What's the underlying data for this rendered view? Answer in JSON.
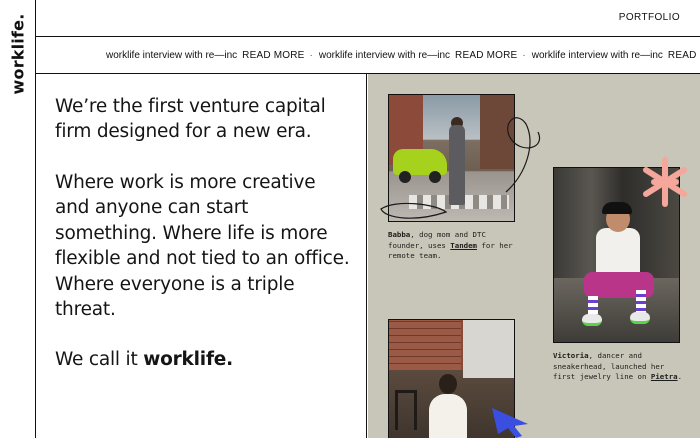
{
  "brand": {
    "logo_text": "worklife."
  },
  "nav": {
    "portfolio_label": "PORTFOLIO"
  },
  "ticker": {
    "items": [
      {
        "text": "worklife interview with re—inc",
        "link": "READ MORE",
        "separator": "·"
      },
      {
        "text": "worklife interview with re—inc",
        "link": "READ MORE",
        "separator": "·"
      },
      {
        "text": "worklife interview with re—inc",
        "link": "READ MORE",
        "separator": ""
      }
    ]
  },
  "main": {
    "intro": "We’re the first venture capital firm designed for a new era.",
    "body": "Where work is more creative and anyone can start something. Where life is more flexible and not tied to an office. Where everyone is a triple threat.",
    "closing_prefix": "We call it",
    "closing_emphasis": "worklife."
  },
  "gallery": {
    "captions": [
      {
        "name": "Babba",
        "text_before": ", dog mom and DTC founder, uses ",
        "link": "Tandem",
        "text_after": " for her remote team."
      },
      {
        "name": "Victoria",
        "text_before": ", dancer and sneakerhead, launched her first jewelry line on ",
        "link": "Pietra",
        "text_after": "."
      }
    ],
    "colors": {
      "background": "#c8c6b8",
      "asterisk": "#f4a79a",
      "cursor": "#3a4fe0",
      "car": "#a6d21e"
    }
  }
}
